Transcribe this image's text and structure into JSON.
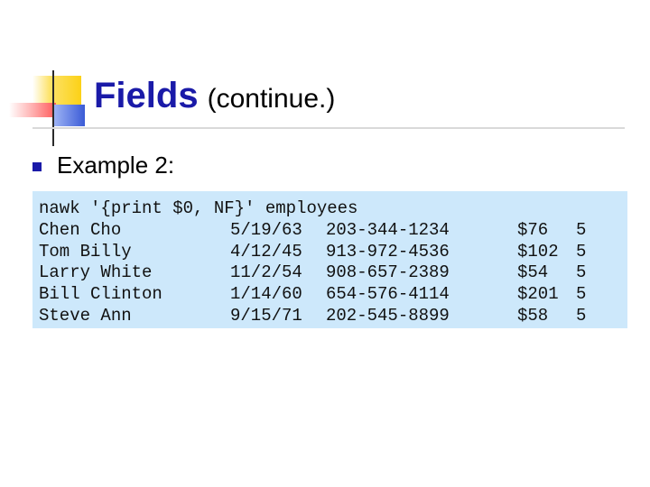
{
  "slide": {
    "title": "Fields",
    "subtitle": "(continue.)"
  },
  "bullet": {
    "text": "Example 2:"
  },
  "code": {
    "command": "nawk '{print $0, NF}' employees",
    "rows": [
      {
        "name": "Chen Cho",
        "date": "5/19/63",
        "phone": "203-344-1234",
        "amount": "$76",
        "nf": "5"
      },
      {
        "name": "Tom Billy",
        "date": "4/12/45",
        "phone": "913-972-4536",
        "amount": "$102",
        "nf": "5"
      },
      {
        "name": "Larry White",
        "date": "11/2/54",
        "phone": "908-657-2389",
        "amount": "$54",
        "nf": "5"
      },
      {
        "name": "Bill Clinton",
        "date": "1/14/60",
        "phone": "654-576-4114",
        "amount": "$201",
        "nf": "5"
      },
      {
        "name": "Steve Ann",
        "date": "9/15/71",
        "phone": "202-545-8899",
        "amount": "$58",
        "nf": "5"
      }
    ]
  },
  "colors": {
    "title": "#1a1aa8",
    "code_background": "#cde8fb",
    "deco_yellow": "#fcd116",
    "deco_red": "#ff6e6e",
    "deco_blue": "#3b5bd6"
  }
}
